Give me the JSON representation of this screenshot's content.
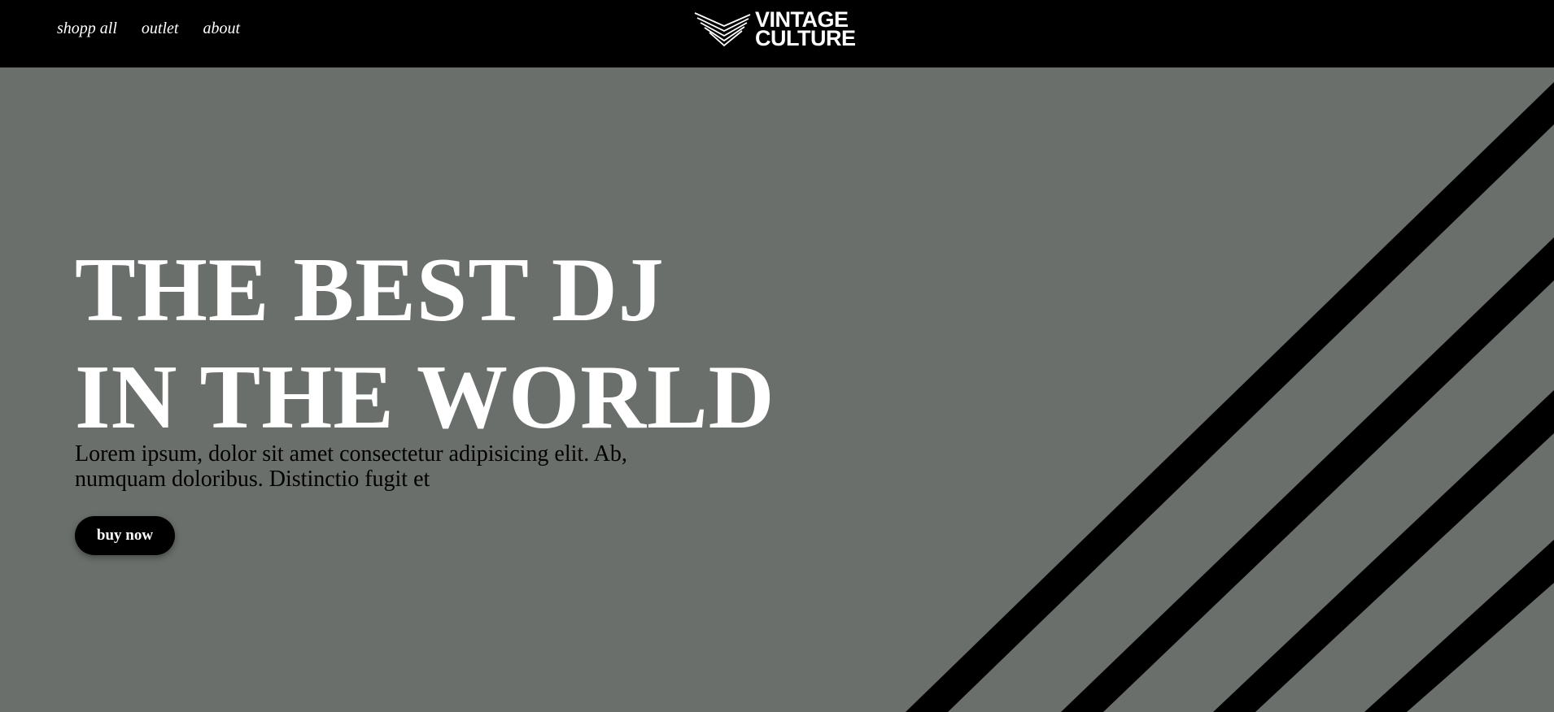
{
  "nav": {
    "items": [
      {
        "label": "shopp all"
      },
      {
        "label": "outlet"
      },
      {
        "label": "about"
      }
    ]
  },
  "logo": {
    "line1": "VINTAGE",
    "line2": "CULTURE",
    "icon": "stacked-chevron-logo-icon"
  },
  "hero": {
    "headline_line1": "THE BEST DJ",
    "headline_line2": "IN THE WORLD",
    "body": "Lorem ipsum, dolor sit amet consectetur adipisicing elit. Ab, numquam doloribus. Distinctio fugit et",
    "cta_label": "buy now"
  },
  "colors": {
    "header_bg": "#000000",
    "hero_bg": "#6a6f6b",
    "stripe": "#000000",
    "text_light": "#ffffff",
    "text_dark": "#000000"
  }
}
